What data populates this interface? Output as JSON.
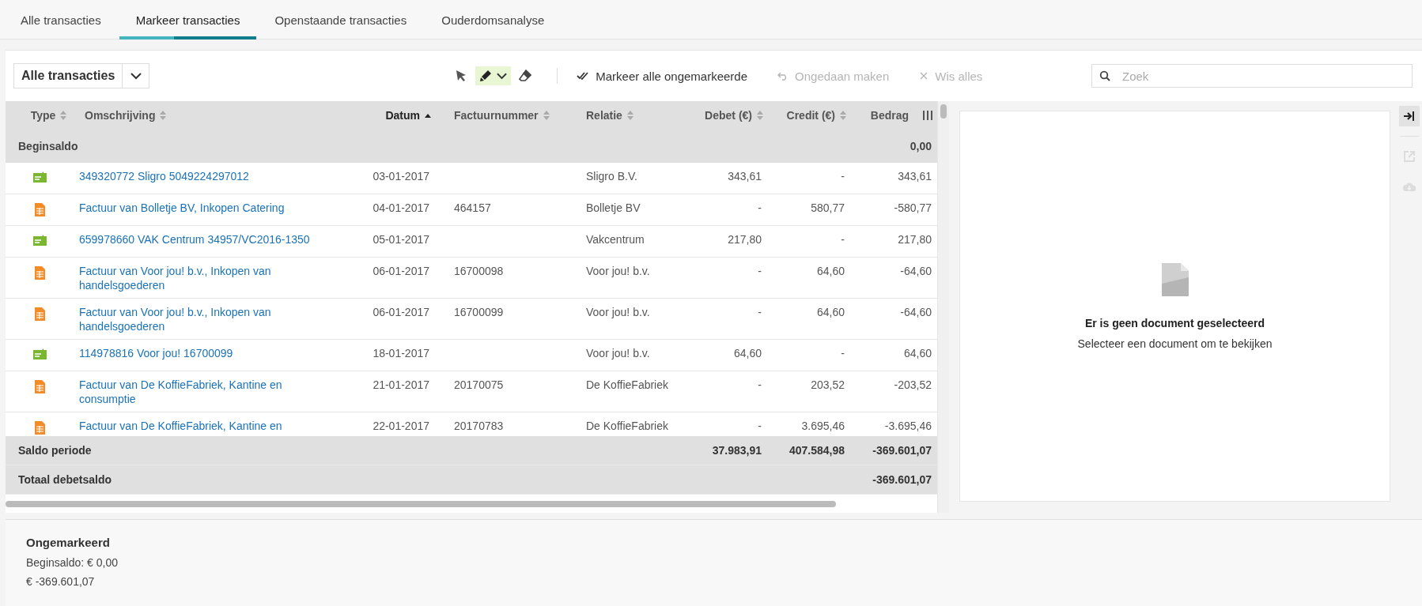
{
  "tabs": [
    {
      "label": "Alle transacties",
      "selected": false
    },
    {
      "label": "Markeer transacties",
      "selected": true
    },
    {
      "label": "Openstaande transacties",
      "selected": false
    },
    {
      "label": "Ouderdomsanalyse",
      "selected": false
    }
  ],
  "toolbar": {
    "view_select": "Alle transacties",
    "tools": [
      {
        "kind": "pointer",
        "selected": false
      },
      {
        "kind": "marker",
        "selected": true
      },
      {
        "kind": "eraser",
        "selected": false
      }
    ],
    "actions": [
      {
        "kind": "mark_all",
        "label": "Markeer alle ongemarkeerde",
        "disabled": false
      },
      {
        "kind": "undo",
        "label": "Ongedaan maken",
        "disabled": true
      },
      {
        "kind": "clear",
        "label": "Wis alles",
        "disabled": true
      }
    ],
    "search": {
      "placeholder": "Zoek"
    }
  },
  "table": {
    "columns": [
      {
        "label": "Type",
        "sorted": false
      },
      {
        "label": "Omschrijving",
        "sorted": false
      },
      {
        "label": "Datum",
        "sorted": true
      },
      {
        "label": "Factuurnummer",
        "sorted": false
      },
      {
        "label": "Relatie",
        "sorted": false
      },
      {
        "label": "Debet (€)",
        "sorted": false
      },
      {
        "label": "Credit (€)",
        "sorted": false
      },
      {
        "label": "Bedrag"
      }
    ],
    "opening_row": {
      "label": "Beginsaldo",
      "amount": "0,00"
    },
    "rows": [
      {
        "kind": "bank",
        "description": "349320772 Sligro 5049224297012",
        "date": "03-01-2017",
        "relation": "Sligro B.V.",
        "debit": "343,61",
        "credit": "-",
        "amount": "343,61"
      },
      {
        "kind": "invoice",
        "description": "Factuur van Bolletje BV, Inkopen Catering",
        "date": "04-01-2017",
        "invoice": "464157",
        "relation": "Bolletje BV",
        "debit": "-",
        "credit": "580,77",
        "amount": "-580,77"
      },
      {
        "kind": "bank",
        "description": "659978660 VAK Centrum 34957/VC2016-1350",
        "date": "05-01-2017",
        "relation": "Vakcentrum",
        "debit": "217,80",
        "credit": "-",
        "amount": "217,80"
      },
      {
        "kind": "invoice",
        "description": "Factuur van Voor jou! b.v., Inkopen van handelsgoederen",
        "date": "06-01-2017",
        "invoice": "16700098",
        "relation": "Voor jou! b.v.",
        "debit": "-",
        "credit": "64,60",
        "amount": "-64,60"
      },
      {
        "kind": "invoice",
        "description": "Factuur van Voor jou! b.v., Inkopen van handelsgoederen",
        "date": "06-01-2017",
        "invoice": "16700099",
        "relation": "Voor jou! b.v.",
        "debit": "-",
        "credit": "64,60",
        "amount": "-64,60"
      },
      {
        "kind": "bank",
        "description": "114978816 Voor jou! 16700099",
        "date": "18-01-2017",
        "relation": "Voor jou! b.v.",
        "debit": "64,60",
        "credit": "-",
        "amount": "64,60"
      },
      {
        "kind": "invoice",
        "description": "Factuur van De KoffieFabriek, Kantine en consumptie",
        "date": "21-01-2017",
        "invoice": "20170075",
        "relation": "De KoffieFabriek",
        "debit": "-",
        "credit": "203,52",
        "amount": "-203,52"
      },
      {
        "kind": "invoice",
        "description": "Factuur van De KoffieFabriek, Kantine en",
        "date": "22-01-2017",
        "invoice": "20170783",
        "relation": "De KoffieFabriek",
        "debit": "-",
        "credit": "3.695,46",
        "amount": "-3.695,46"
      }
    ],
    "totals": [
      {
        "label": "Saldo periode",
        "debit": "37.983,91",
        "credit": "407.584,98",
        "amount": "-369.601,07"
      },
      {
        "label": "Totaal debetsaldo",
        "amount": "-369.601,07"
      }
    ]
  },
  "preview": {
    "title": "Er is geen document geselecteerd",
    "message": "Selecteer een document om te bekijken"
  },
  "side_tools": [
    {
      "kind": "collapse",
      "disabled": false
    },
    {
      "kind": "open_external",
      "disabled": true
    },
    {
      "kind": "download",
      "disabled": true
    }
  ],
  "summary": {
    "title": "Ongemarkeerd",
    "lines": [
      "Beginsaldo: € 0,00",
      "€ -369.601,07"
    ]
  }
}
